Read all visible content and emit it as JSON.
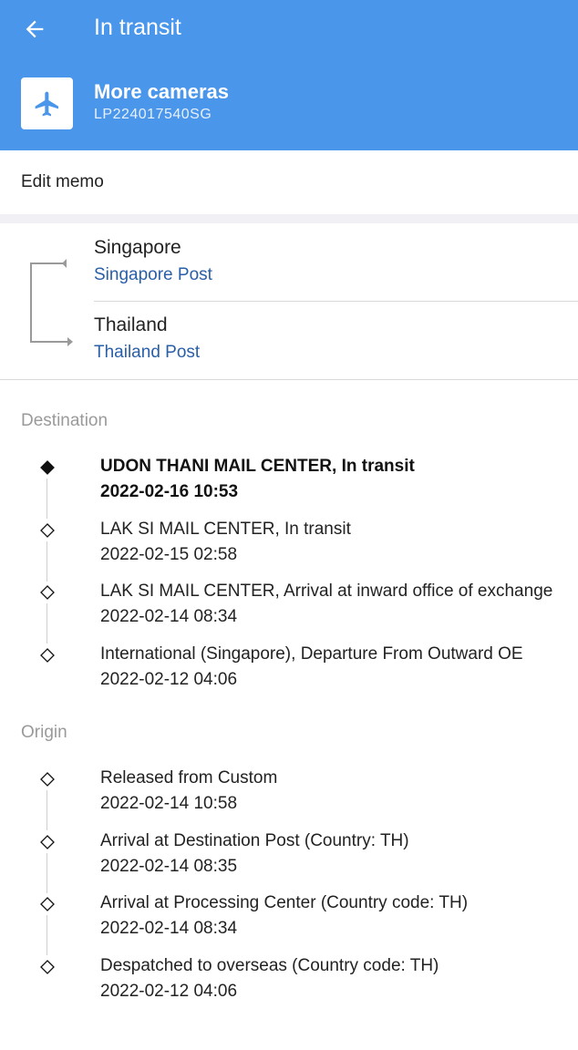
{
  "header": {
    "title": "In transit",
    "package_name": "More cameras",
    "tracking_number": "LP224017540SG",
    "background_color": "#4a96eb",
    "back_icon": "arrow-left-icon",
    "package_icon": "airplane-icon"
  },
  "memo": {
    "label": "Edit memo"
  },
  "route": {
    "origin_country": "Singapore",
    "origin_carrier": "Singapore Post",
    "destination_country": "Thailand",
    "destination_carrier": "Thailand Post",
    "carrier_link_color": "#2a5fa8"
  },
  "destination_section": {
    "label": "Destination",
    "events": [
      {
        "description": "UDON THANI MAIL CENTER, In transit",
        "time": "2022-02-16 10:53",
        "latest": true
      },
      {
        "description": "LAK SI MAIL CENTER, In transit",
        "time": "2022-02-15 02:58"
      },
      {
        "description": "LAK SI MAIL CENTER, Arrival at inward office of exchange",
        "time": "2022-02-14 08:34"
      },
      {
        "description": "International (Singapore), Departure From Outward OE",
        "time": "2022-02-12 04:06"
      }
    ]
  },
  "origin_section": {
    "label": "Origin",
    "events": [
      {
        "description": "Released from Custom",
        "time": "2022-02-14 10:58"
      },
      {
        "description": "Arrival at Destination Post (Country: TH)",
        "time": "2022-02-14 08:35"
      },
      {
        "description": "Arrival at Processing Center (Country code: TH)",
        "time": "2022-02-14 08:34"
      },
      {
        "description": "Despatched to overseas (Country code: TH)",
        "time": "2022-02-12 04:06"
      }
    ]
  }
}
